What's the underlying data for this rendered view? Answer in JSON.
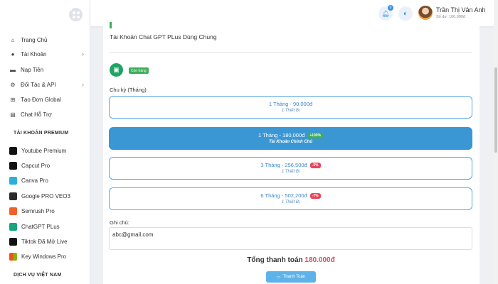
{
  "sidebar": {
    "items": [
      {
        "label": "Trang Chủ",
        "icon": "home-icon"
      },
      {
        "label": "Tài Khoản",
        "icon": "user-icon"
      },
      {
        "label": "Nạp Tiền",
        "icon": "card-icon"
      },
      {
        "label": "Đối Tác & API",
        "icon": "api-icon"
      },
      {
        "label": "Tạo Đơn Global",
        "icon": "cart-icon"
      },
      {
        "label": "Chat Hỗ Trợ",
        "icon": "chat-icon"
      }
    ],
    "premium_title": "TÀI KHOẢN PREMIUM",
    "premium": [
      {
        "label": "Youtube Premium",
        "color": "#111111"
      },
      {
        "label": "Capcut Pro",
        "color": "#111111"
      },
      {
        "label": "Canva Pro",
        "color": "#2bb0d8"
      },
      {
        "label": "Google PRO VEO3",
        "color": "#2b2b2b"
      },
      {
        "label": "Semrush Pro",
        "color": "#f0602a"
      },
      {
        "label": "ChatGPT PLus",
        "color": "#19a37f"
      },
      {
        "label": "Tiktok Đã Mở Live",
        "color": "#111111"
      },
      {
        "label": "Key Windows Pro",
        "color": "#f25022"
      }
    ],
    "vn_title": "DỊCH VỤ VIỆT NAM"
  },
  "header": {
    "notification_count": "0",
    "user_name": "Trần Thị Vân Anh",
    "balance": "Số dư: 100,000đ"
  },
  "product": {
    "title": "Tài Khoản Chat GPT PLus Dùng Chung",
    "stock_badge": "Còn hàng",
    "cycle_label": "Chu kỳ (Tháng)",
    "options": [
      {
        "title": "1 Tháng - 90,000đ",
        "sub": "1 Thiết Bị",
        "badge": "",
        "selected": false
      },
      {
        "title": "1 Tháng - 180,000đ",
        "sub": "Tài Khoản Chính Chủ",
        "badge": "+100%",
        "selected": true
      },
      {
        "title": "3 Tháng - 256,500đ",
        "sub": "1 Thiết Bị",
        "badge": "-5%",
        "selected": false
      },
      {
        "title": "6 Tháng - 502,200đ",
        "sub": "1 Thiết Bị",
        "badge": "-7%",
        "selected": false
      }
    ],
    "note_label": "Ghi chú:",
    "note_value": "abc@gmail.com",
    "total_label": "Tổng thanh toán",
    "total_amount": "180.000đ",
    "pay_label": "Thanh Toán"
  }
}
